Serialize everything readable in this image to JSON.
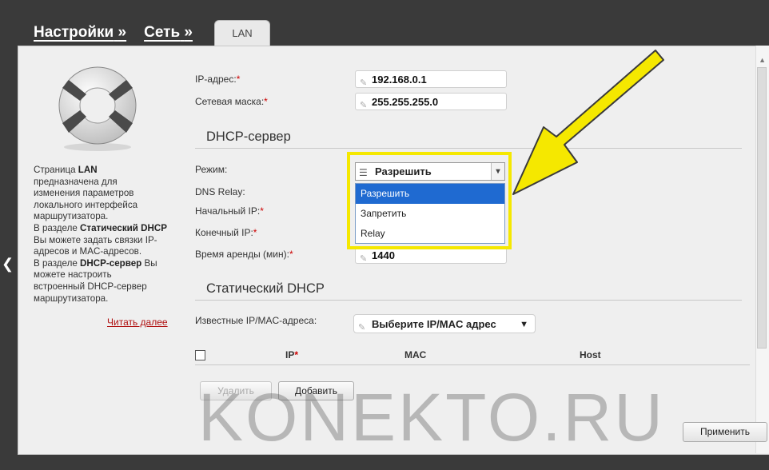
{
  "header": {
    "crumb1": "Настройки",
    "crumb2": "Сеть",
    "sep": "»",
    "tab": "LAN"
  },
  "sidebar": {
    "text_lines": [
      {
        "text": "Страница ",
        "bold": "LAN"
      },
      {
        "text": "предназначена для"
      },
      {
        "text": "изменения параметров"
      },
      {
        "text": "локального интерфейса"
      },
      {
        "text": "маршрутизатора."
      },
      {
        "text": "В разделе ",
        "bold": "Статический DHCP"
      },
      {
        "text": "Вы можете задать связки IP-"
      },
      {
        "text": "адресов и MAC-адресов."
      },
      {
        "text": "В разделе ",
        "bold": "DHCP-сервер",
        "tail": " Вы"
      },
      {
        "text": "можете настроить"
      },
      {
        "text": "встроенный DHCP-сервер"
      },
      {
        "text": "маршрутизатора."
      }
    ],
    "read_more": "Читать далее"
  },
  "lan": {
    "ip_label": "IP-адрес:",
    "ip_value": "192.168.0.1",
    "mask_label": "Сетевая маска:",
    "mask_value": "255.255.255.0"
  },
  "dhcp": {
    "title": "DHCP-сервер",
    "mode_label": "Режим:",
    "mode_value": "Разрешить",
    "dns_relay_label": "DNS Relay:",
    "start_ip_label": "Начальный IP:",
    "end_ip_label": "Конечный IP:",
    "lease_label": "Время аренды (мин):",
    "lease_value": "1440",
    "options": [
      "Разрешить",
      "Запретить",
      "Relay"
    ]
  },
  "static_dhcp": {
    "title": "Статический DHCP",
    "known_label": "Известные IP/MAC-адреса:",
    "select_placeholder": "Выберите IP/MAC адрес",
    "col_ip": "IP",
    "col_mac": "MAC",
    "col_host": "Host"
  },
  "buttons": {
    "delete": "Удалить",
    "add": "Добавить",
    "apply": "Применить"
  },
  "watermark": "KONEKTO.RU",
  "required_mark": "*",
  "colors": {
    "highlight": "#f5e800",
    "selected": "#1f6ad1",
    "link": "#b01010"
  }
}
